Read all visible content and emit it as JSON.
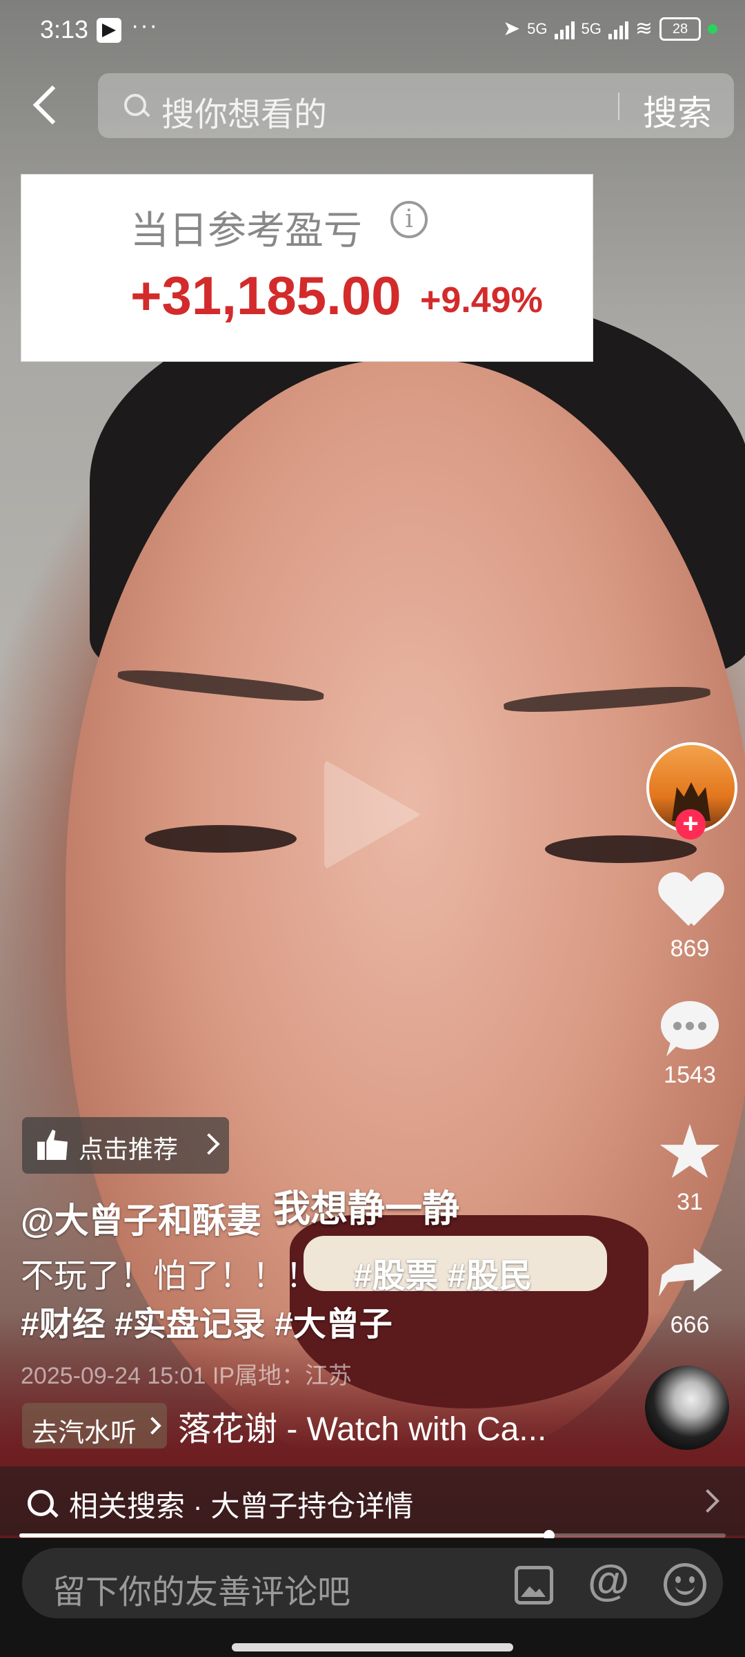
{
  "status": {
    "time": "3:13",
    "more": "···",
    "net1": "5G",
    "net2": "5G",
    "battery": "28"
  },
  "search": {
    "placeholder": "搜你想看的",
    "button": "搜索"
  },
  "pnl_card": {
    "title": "当日参考盈亏",
    "info": "i",
    "amount": "+31,185.00",
    "percent": "+9.49%"
  },
  "video": {
    "caption_overlay": "我想静一静"
  },
  "actions": {
    "likes": "869",
    "comments": "1543",
    "favorites": "31",
    "shares": "666"
  },
  "recommend": {
    "label": "点击推荐"
  },
  "post": {
    "author": "@大曾子和酥妻",
    "desc_text": "不玩了！怕了！！！",
    "tags_line1": "#股票 #股民",
    "tags_line2": "#财经 #实盘记录 #大曾子",
    "meta": "2025-09-24 15:01  IP属地：江苏"
  },
  "music": {
    "chip": "去汽水听",
    "title": "落花谢 - Watch with Ca..."
  },
  "related": {
    "text": "相关搜索 · 大曾子持仓详情"
  },
  "progress": {
    "played_fraction": 0.75
  },
  "comment_bar": {
    "placeholder": "留下你的友善评论吧",
    "at": "@"
  },
  "colors": {
    "accent": "#fe2c55",
    "gain": "#d32b2b"
  }
}
